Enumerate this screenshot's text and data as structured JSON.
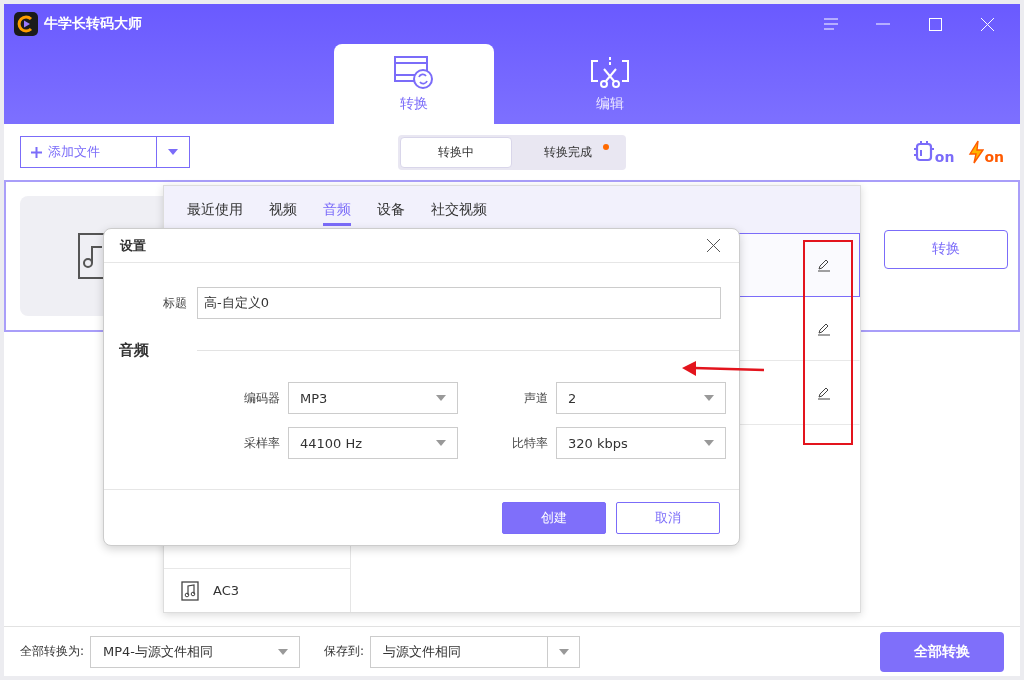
{
  "window": {
    "title": "牛学长转码大师"
  },
  "main_tabs": [
    {
      "label": "转换",
      "kind": "convert",
      "selected": true
    },
    {
      "label": "编辑",
      "kind": "edit",
      "selected": false
    }
  ],
  "toolbar": {
    "add_button": "添加文件",
    "status_tabs": [
      {
        "label": "转换中",
        "selected": true,
        "badge": false
      },
      {
        "label": "转换完成",
        "selected": false,
        "badge": true
      }
    ],
    "toggles": [
      {
        "kind": "chip",
        "badge": "on"
      },
      {
        "kind": "bolt",
        "badge": "on"
      }
    ]
  },
  "file_item": {
    "convert_button": "转换"
  },
  "format_panel": {
    "tabs": [
      {
        "label": "最近使用",
        "selected": false
      },
      {
        "label": "视频",
        "selected": false
      },
      {
        "label": "音频",
        "selected": true
      },
      {
        "label": "设备",
        "selected": false
      },
      {
        "label": "社交视频",
        "selected": false
      }
    ],
    "formats": [
      {
        "label": "AC3",
        "kind": "note"
      }
    ],
    "presets": [
      {
        "selected": true
      },
      {
        "selected": false
      },
      {
        "selected": false
      }
    ]
  },
  "dialog": {
    "title": "设置",
    "title_label": "标题",
    "title_value": "高-自定义0",
    "section": "音频",
    "fields": [
      {
        "label": "编码器",
        "value": "MP3"
      },
      {
        "label": "声道",
        "value": "2"
      },
      {
        "label": "采样率",
        "value": "44100 Hz"
      },
      {
        "label": "比特率",
        "value": "320 kbps"
      }
    ],
    "buttons": [
      {
        "label": "创建",
        "primary": true
      },
      {
        "label": "取消",
        "primary": false
      }
    ]
  },
  "bottom_bar": {
    "convert_all_label": "全部转换为:",
    "convert_all_value": "MP4-与源文件相同",
    "save_label": "保存到:",
    "save_value": "与源文件相同",
    "convert_all_button": "全部转换"
  }
}
